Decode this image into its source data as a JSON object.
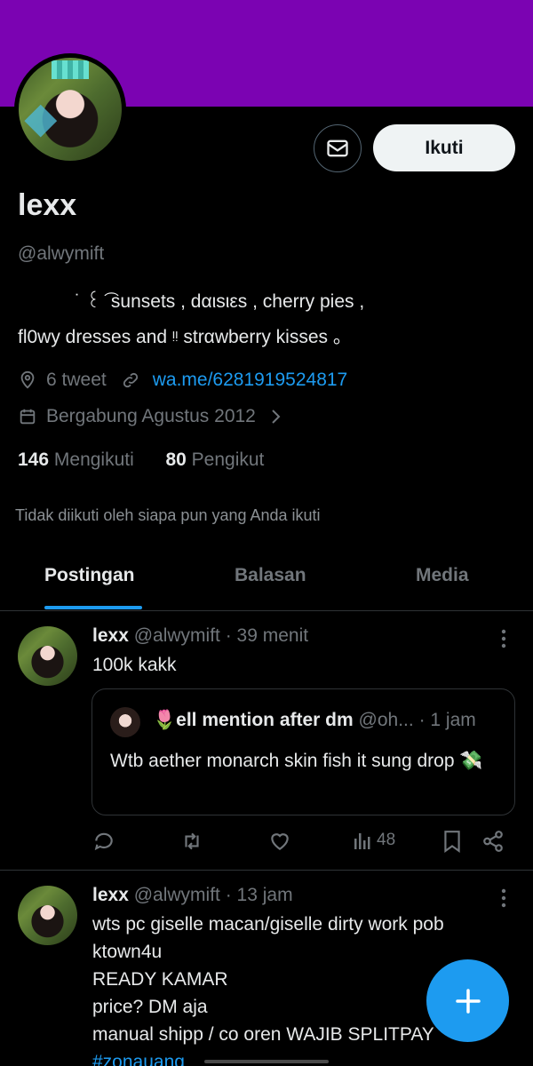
{
  "colors": {
    "banner": "#7b03b2",
    "accent": "#1d9bf0",
    "background": "#000000"
  },
  "profile": {
    "follow_label": "Ikuti",
    "name": "lexx",
    "handle": "@alwymift",
    "bio_line1": "˙ ꒰ ͡ sunsets , dαιsιεs , cherry pies ,",
    "bio_line2": "fl0wy dresses and ᵎᵎ strαwberry kisses 。",
    "tweets": "6 tweet",
    "link": "wa.me/6281919524817",
    "joined": "Bergabung Agustus 2012",
    "following_count": "146",
    "following_label": "Mengikuti",
    "followers_count": "80",
    "followers_label": "Pengikut",
    "not_followed": "Tidak diikuti oleh siapa pun yang Anda ikuti"
  },
  "tabs": [
    {
      "label": "Postingan"
    },
    {
      "label": "Balasan"
    },
    {
      "label": "Media"
    }
  ],
  "posts": [
    {
      "name": "lexx",
      "handle": "@alwymift",
      "time": "· 39 menit",
      "text": "100k kakk",
      "quote": {
        "name": "🌷ell mention after dm",
        "handle": "@oh...",
        "time": "· 1 jam",
        "text": "Wtb aether monarch skin fish it sung drop 💸"
      },
      "views": "48"
    },
    {
      "name": "lexx",
      "handle": "@alwymift",
      "time": "· 13 jam",
      "lines": [
        "wts pc giselle macan/giselle dirty work pob",
        "ktown4u",
        "READY KAMAR",
        "price? DM aja",
        "manual shipp / co oren WAJIB SPLITPAY"
      ],
      "hashtag": "#zonauang"
    }
  ],
  "icons": {
    "message": "envelope-icon",
    "location": "location-pin-icon",
    "link": "link-icon",
    "calendar": "calendar-icon",
    "reply": "reply-icon",
    "retweet": "retweet-icon",
    "like": "heart-icon",
    "views": "views-chart-icon",
    "bookmark": "bookmark-icon",
    "share": "share-icon",
    "compose": "plus-icon"
  }
}
